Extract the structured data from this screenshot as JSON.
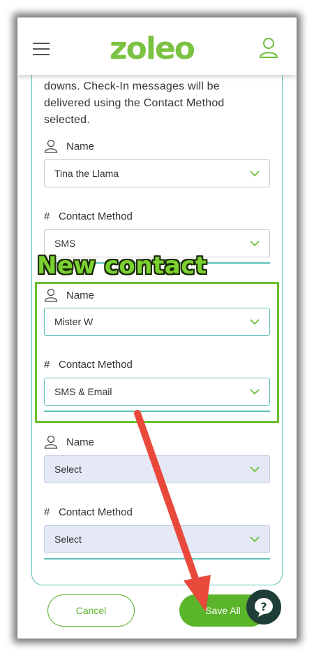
{
  "header": {
    "menu_icon": "hamburger-menu-icon",
    "logo_text": "zoleo",
    "user_icon": "user-profile-icon"
  },
  "intro": {
    "text": "downs. Check-In messages will be delivered using the Contact Method selected."
  },
  "contacts": [
    {
      "name_label": "Name",
      "name_value": "Tina the Llama",
      "method_label": "Contact Method",
      "method_value": "SMS"
    },
    {
      "name_label": "Name",
      "name_value": "Mister W",
      "method_label": "Contact Method",
      "method_value": "SMS & Email"
    },
    {
      "name_label": "Name",
      "name_value": "Select",
      "method_label": "Contact Method",
      "method_value": "Select"
    }
  ],
  "annotation": {
    "label": "New contact",
    "color": "#6ac12e",
    "arrow_color": "#e9493a"
  },
  "footer": {
    "cancel_label": "Cancel",
    "save_label": "Save All",
    "help_icon": "question-help-icon"
  },
  "colors": {
    "brand_green": "#5ab52b",
    "teal": "#5bc0b8",
    "help_bg": "#1e3e37"
  }
}
